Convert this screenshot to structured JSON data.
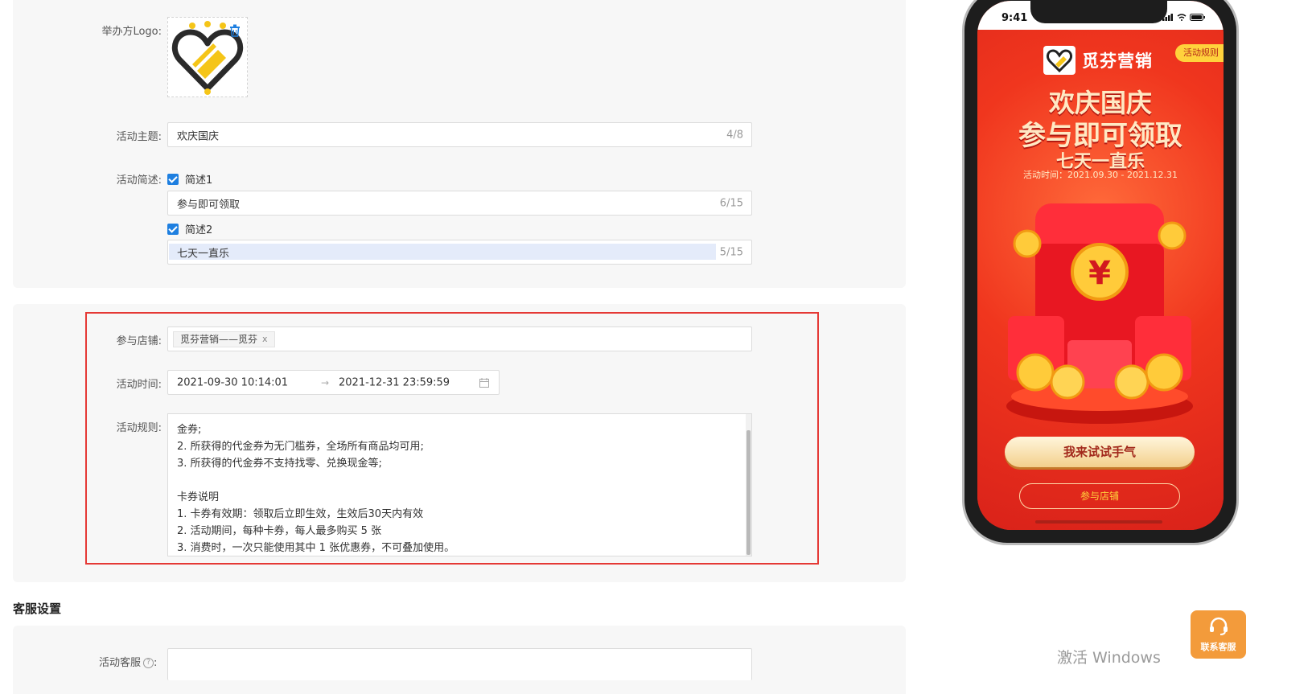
{
  "form": {
    "logo_label": "举办方Logo:",
    "theme_label": "活动主题:",
    "theme_value": "欢庆国庆",
    "theme_count": "4/8",
    "desc_label": "活动简述:",
    "desc1_check_label": "简述1",
    "desc1_value": "参与即可领取",
    "desc1_count": "6/15",
    "desc2_check_label": "简述2",
    "desc2_value": "七天一直乐",
    "desc2_count": "5/15",
    "store_label": "参与店铺:",
    "store_tag": "觅芬营销——觅芬",
    "store_tag_remove": "x",
    "time_label": "活动时间:",
    "time_start": "2021-09-30 10:14:01",
    "time_arrow": "→",
    "time_end": "2021-12-31 23:59:59",
    "rules_label": "活动规则:",
    "rules_lines": [
      "金券;",
      "2. 所获得的代金券为无门槛券，全场所有商品均可用;",
      "3. 所获得的代金券不支持找零、兑换现金等;",
      "",
      "卡券说明",
      "1. 卡券有效期：领取后立即生效，生效后30天内有效",
      "2. 活动期间，每种卡券，每人最多购买 5 张",
      "3. 消费时，一次只能使用其中 1 张优惠券，不可叠加使用。"
    ],
    "service_section_title": "客服设置",
    "service_label": "活动客服",
    "help_glyph": "?"
  },
  "phone": {
    "time": "9:41",
    "rule_badge": "活动规则",
    "brand_name": "觅芬营销",
    "title_line1": "欢庆国庆",
    "title_line2": "参与即可领取",
    "title_line3": "七天一直乐",
    "date_text": "活动时间：2021.09.30 - 2021.12.31",
    "try_button": "我来试试手气",
    "shop_button": "参与店铺"
  },
  "overlay": {
    "watermark": "激活 Windows",
    "service_button": "联系客服"
  },
  "colors": {
    "accent_blue": "#1e7fe0",
    "highlight_red": "#e53935",
    "phone_red": "#e8321f",
    "service_orange": "#f39b3b"
  }
}
